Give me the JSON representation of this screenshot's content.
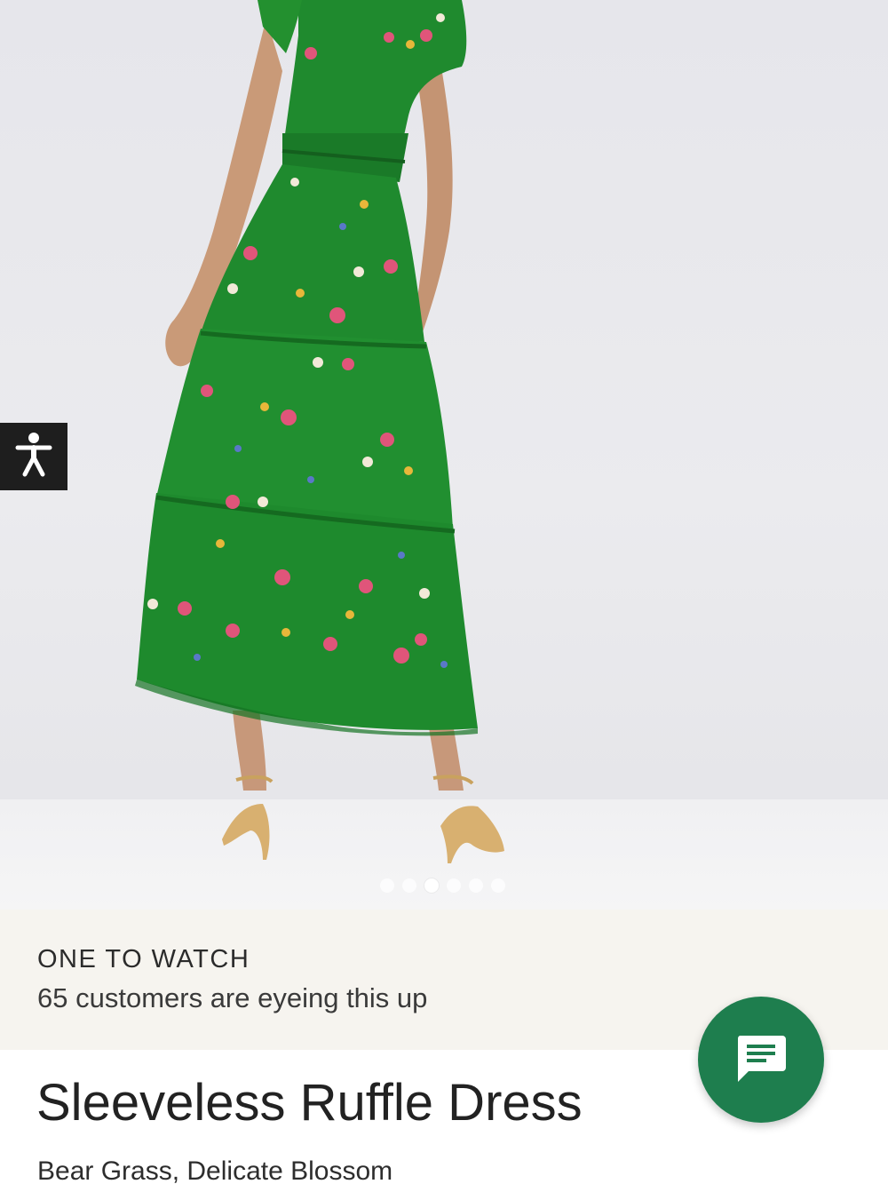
{
  "gallery": {
    "image_alt": "Model wearing green floral tiered midi dress, back view",
    "slide_count": 6,
    "active_slide": 3
  },
  "accessibility": {
    "icon": "accessibility-person-icon"
  },
  "watch_banner": {
    "title": "ONE TO WATCH",
    "subtitle": "65 customers are eyeing this up"
  },
  "product": {
    "title": "Sleeveless Ruffle Dress",
    "subtitle": "Bear Grass, Delicate Blossom"
  },
  "chat": {
    "icon": "chat-message-icon"
  },
  "colors": {
    "accent_green": "#1e7e4e",
    "banner_bg": "#f6f4ef",
    "dress_green": "#1f8a2e"
  }
}
